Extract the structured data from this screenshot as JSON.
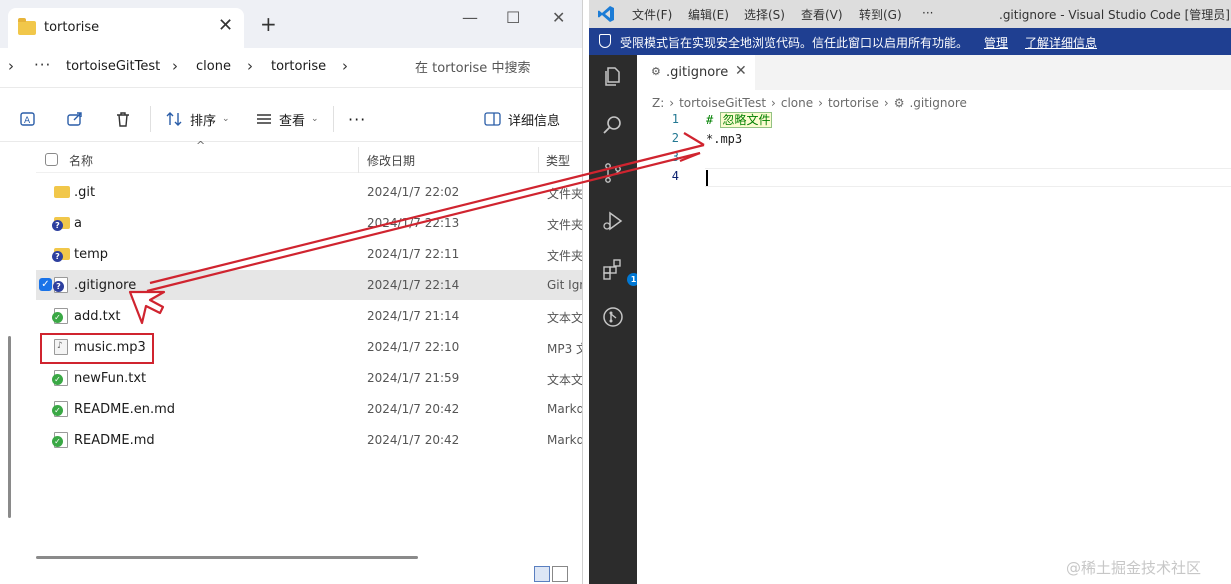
{
  "explorer": {
    "tab_title": "tortorise",
    "tab_close": "✕",
    "new_tab": "+",
    "window_controls": {
      "minimize": "—",
      "maximize": "☐",
      "close": "✕"
    },
    "breadcrumbs": [
      "tortoiseGitTest",
      "clone",
      "tortorise"
    ],
    "more": "···",
    "search_placeholder": "在 tortorise 中搜索",
    "toolbar": {
      "sort_label": "排序",
      "view_label": "查看",
      "more": "···",
      "details_label": "详细信息"
    },
    "columns": {
      "name": "名称",
      "modified": "修改日期",
      "type": "类型"
    },
    "files": [
      {
        "name": ".git",
        "date": "2024/1/7 22:02",
        "type": "文件夹",
        "icon": "folder-icon"
      },
      {
        "name": "a",
        "date": "2024/1/7 22:13",
        "type": "文件夹",
        "icon": "folder-unversioned-icon"
      },
      {
        "name": "temp",
        "date": "2024/1/7 22:11",
        "type": "文件夹",
        "icon": "folder-unversioned-icon"
      },
      {
        "name": ".gitignore",
        "date": "2024/1/7 22:14",
        "type": "Git Ign",
        "icon": "file-unversioned-icon",
        "selected": true
      },
      {
        "name": "add.txt",
        "date": "2024/1/7 21:14",
        "type": "文本文",
        "icon": "file-committed-icon"
      },
      {
        "name": "music.mp3",
        "date": "2024/1/7 22:10",
        "type": "MP3 文",
        "icon": "audio-file-icon"
      },
      {
        "name": "newFun.txt",
        "date": "2024/1/7 21:59",
        "type": "文本文",
        "icon": "file-committed-icon"
      },
      {
        "name": "README.en.md",
        "date": "2024/1/7 20:42",
        "type": "Markd",
        "icon": "file-committed-icon"
      },
      {
        "name": "README.md",
        "date": "2024/1/7 20:42",
        "type": "Markd",
        "icon": "file-committed-icon"
      }
    ]
  },
  "vscode": {
    "menu": [
      "文件(F)",
      "编辑(E)",
      "选择(S)",
      "查看(V)",
      "转到(G)",
      "···"
    ],
    "window_title": ".gitignore - Visual Studio Code [管理员]",
    "banner": {
      "message": "受限模式旨在实现安全地浏览代码。信任此窗口以启用所有功能。",
      "manage_link": "管理",
      "learn_more_link": "了解详细信息"
    },
    "extensions_badge": "1",
    "tab": {
      "icon": "⚙",
      "label": ".gitignore",
      "close": "✕"
    },
    "breadcrumb": [
      "Z:",
      "tortoiseGitTest",
      "clone",
      "tortorise",
      ".gitignore"
    ],
    "lines": [
      {
        "num": "1",
        "prefix": "# ",
        "text": "忽略文件",
        "kind": "comment"
      },
      {
        "num": "2",
        "prefix": "",
        "text": "*.mp3",
        "kind": "plain"
      },
      {
        "num": "3",
        "prefix": "",
        "text": "",
        "kind": "plain"
      },
      {
        "num": "4",
        "prefix": "",
        "text": "",
        "kind": "plain"
      }
    ]
  },
  "watermark": "@稀土掘金技术社区",
  "colors": {
    "annotation_red": "#d0242f",
    "vscode_banner": "#1f3f91",
    "activity_bar": "#2c2c2c",
    "selection_row": "#e6e6e6",
    "comment_green": "#008000"
  }
}
